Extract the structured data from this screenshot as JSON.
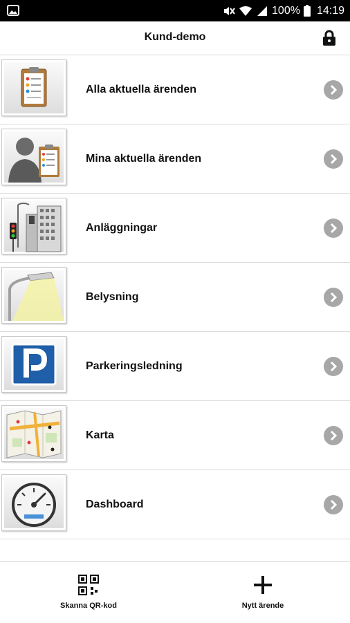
{
  "status_bar": {
    "battery_text": "100%",
    "time": "14:19"
  },
  "header": {
    "title": "Kund-demo",
    "lock_icon": "lock-icon"
  },
  "menu": {
    "items": [
      {
        "label": "Alla aktuella ärenden",
        "icon": "clipboard-icon"
      },
      {
        "label": "Mina aktuella ärenden",
        "icon": "person-clipboard-icon"
      },
      {
        "label": "Anläggningar",
        "icon": "city-traffic-icon"
      },
      {
        "label": "Belysning",
        "icon": "street-lamp-icon"
      },
      {
        "label": "Parkeringsledning",
        "icon": "parking-icon"
      },
      {
        "label": "Karta",
        "icon": "map-icon"
      },
      {
        "label": "Dashboard",
        "icon": "gauge-icon"
      }
    ]
  },
  "bottom_bar": {
    "scan_label": "Skanna QR-kod",
    "new_label": "Nytt ärende"
  },
  "colors": {
    "chevron": "#a7a7a7",
    "parking_blue": "#1f5ea8",
    "divider": "#dcdcdc"
  }
}
